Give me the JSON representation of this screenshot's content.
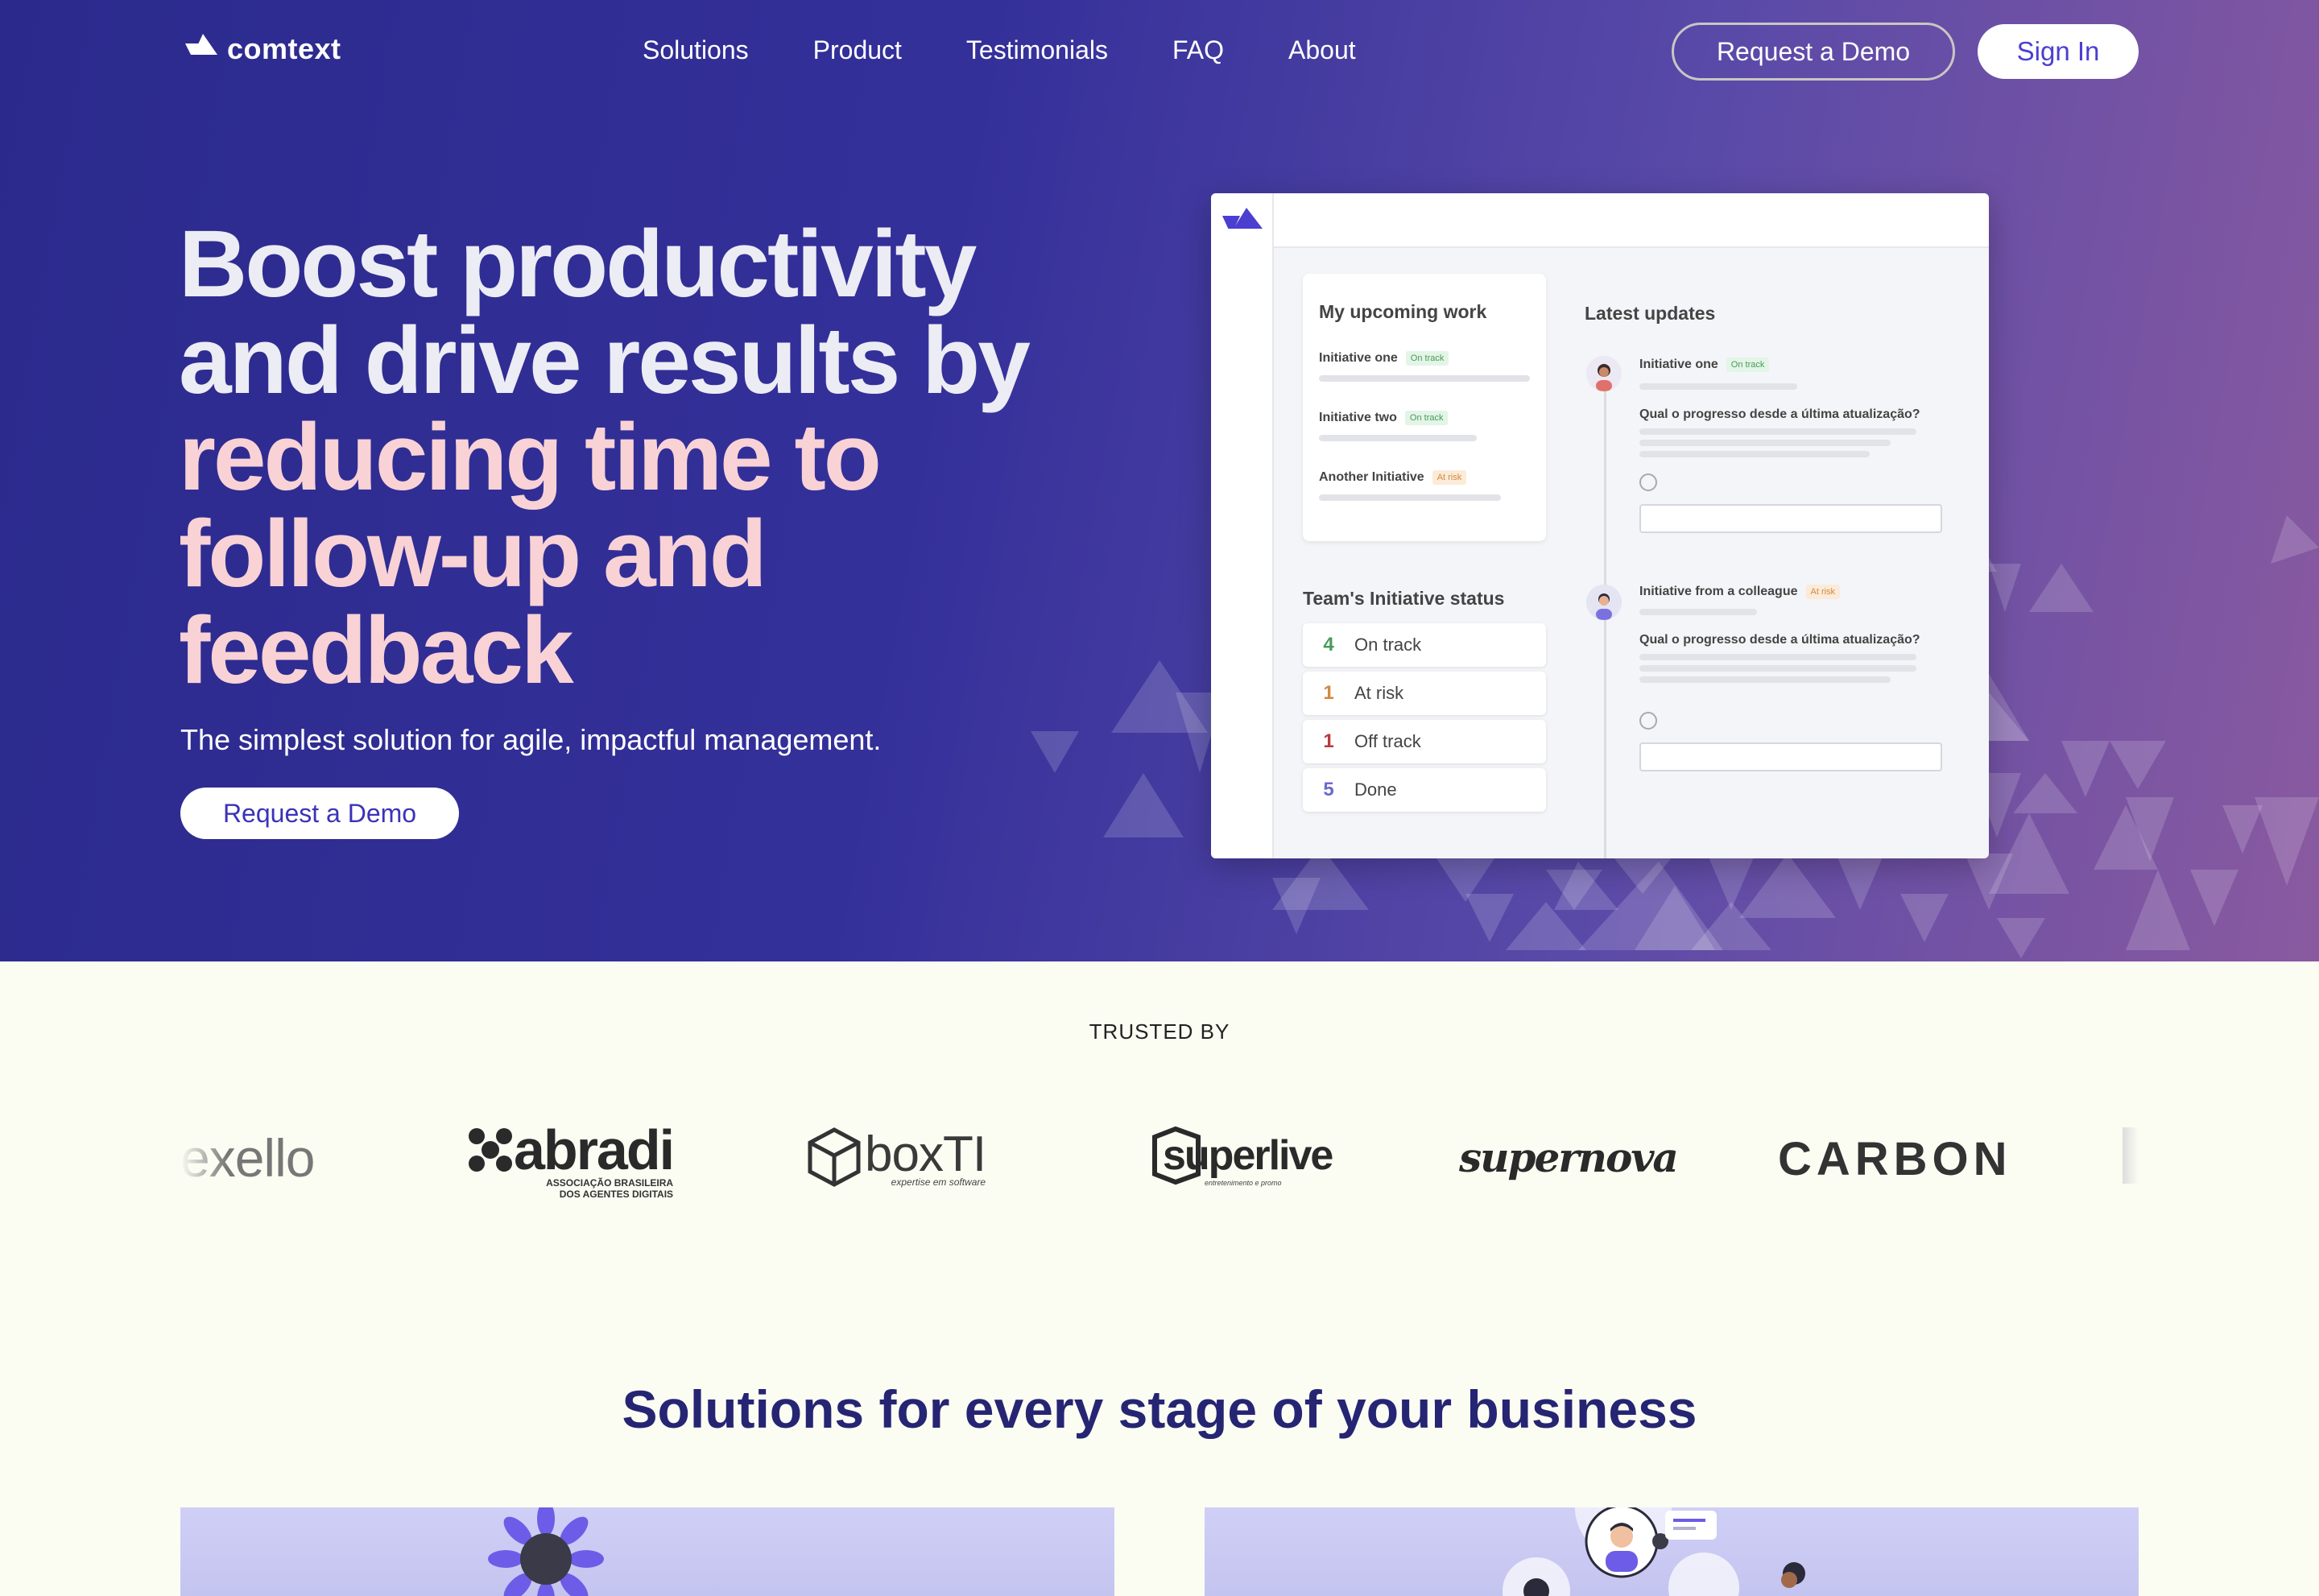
{
  "nav": {
    "brand": "comtext",
    "links": [
      "Solutions",
      "Product",
      "Testimonials",
      "FAQ",
      "About"
    ],
    "demo_label": "Request a Demo",
    "signin_label": "Sign In"
  },
  "hero": {
    "headline_white_1": "Boost productivity",
    "headline_white_2": "and drive results by",
    "headline_pink_1": "reducing time to",
    "headline_pink_2": "follow-up and",
    "headline_pink_3": "feedback",
    "subtitle": "The simplest solution for agile, impactful management.",
    "cta_label": "Request a Demo"
  },
  "mockup": {
    "upcoming_title": "My upcoming work",
    "upcoming_items": [
      {
        "label": "Initiative one",
        "status": "On track"
      },
      {
        "label": "Initiative two",
        "status": "On track"
      },
      {
        "label": "Another Initiative",
        "status": "At risk"
      }
    ],
    "team_title": "Team's Initiative status",
    "team_status": [
      {
        "count": "4",
        "label": "On track",
        "color": "#4a9a5a"
      },
      {
        "count": "1",
        "label": "At risk",
        "color": "#d08a40"
      },
      {
        "count": "1",
        "label": "Off track",
        "color": "#b83a3a"
      },
      {
        "count": "5",
        "label": "Done",
        "color": "#6a6ad0"
      }
    ],
    "updates_title": "Latest updates",
    "updates": [
      {
        "title": "Initiative one",
        "status": "On track",
        "question": "Qual o progresso desde a última atualização?"
      },
      {
        "title": "Initiative from a colleague",
        "status": "At risk",
        "question": "Qual o progresso desde a última atualização?"
      }
    ]
  },
  "trusted": {
    "label": "TRUSTED BY",
    "logos": {
      "exello": "exello",
      "abradi": "abradi",
      "abradi_sub_1": "ASSOCIAÇÃO BRASILEIRA",
      "abradi_sub_2": "DOS AGENTES DIGITAIS",
      "boxti": "boxTI",
      "boxti_sub": "expertise em software",
      "superlive": "superlive",
      "superlive_sub": "entretenimento e promo",
      "supernova": "supernova",
      "carbon": "CARBON"
    }
  },
  "solutions": {
    "title": "Solutions for every stage of your business"
  },
  "colors": {
    "brand": "#4a3fd0",
    "hero_pink": "#f9d2d6",
    "solutions_title": "#262573"
  }
}
